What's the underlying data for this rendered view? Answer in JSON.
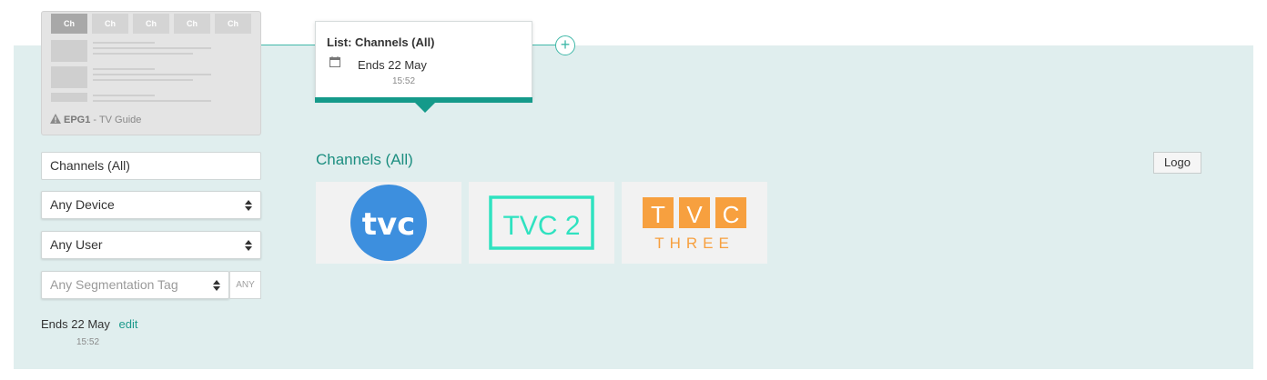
{
  "thumbnail": {
    "tabs": [
      "Ch",
      "Ch",
      "Ch",
      "Ch",
      "Ch"
    ],
    "caption_code": "EPG1",
    "caption_sep": " - ",
    "caption_name": "TV Guide",
    "warning_icon": "warning-triangle-icon"
  },
  "filters": {
    "list_value": "Channels (All)",
    "device_value": "Any Device",
    "user_value": "Any User",
    "segmentation_placeholder": "Any Segmentation Tag",
    "any_label": "ANY"
  },
  "schedule_left": {
    "ends_label": "Ends",
    "date": "22 May",
    "edit_label": "edit",
    "time": "15:52"
  },
  "popup": {
    "title": "List: Channels (All)",
    "ends_label": "Ends",
    "date": "22 May",
    "time": "15:52",
    "icon": "calendar-icon",
    "accent_color": "#159a8a"
  },
  "add_button_symbol": "+",
  "main": {
    "heading": "Channels (All)",
    "logo_button_label": "Logo",
    "channels": [
      {
        "name": "tvc",
        "color": "#3d8fde"
      },
      {
        "name": "TVC 2",
        "color": "#2fe2c0"
      },
      {
        "name": "TVC THREE",
        "letters": [
          "T",
          "V",
          "C"
        ],
        "subtitle": "THREE",
        "color": "#f7a03f"
      }
    ]
  }
}
